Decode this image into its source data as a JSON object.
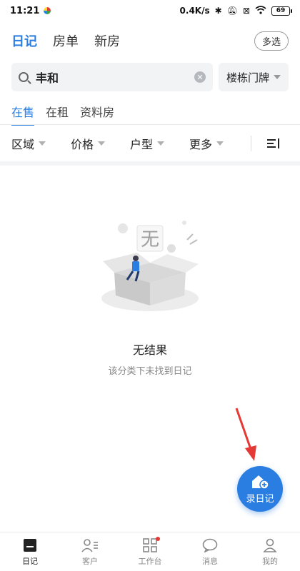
{
  "status_bar": {
    "time": "11:21",
    "speed": "0.4K/s",
    "battery": "69"
  },
  "top_nav": {
    "tabs": [
      {
        "label": "日记",
        "active": true
      },
      {
        "label": "房单",
        "active": false
      },
      {
        "label": "新房",
        "active": false
      }
    ],
    "multi_select_label": "多选"
  },
  "search": {
    "value": "丰和",
    "filter_label": "楼栋门牌"
  },
  "sub_tabs": [
    {
      "label": "在售",
      "active": true
    },
    {
      "label": "在租",
      "active": false
    },
    {
      "label": "资料房",
      "active": false
    }
  ],
  "filters": [
    "区域",
    "价格",
    "户型",
    "更多"
  ],
  "empty_state": {
    "illustration_text": "无",
    "title": "无结果",
    "subtitle": "该分类下未找到日记"
  },
  "fab": {
    "label": "录日记",
    "icon": "house-plus-icon"
  },
  "bottom_tabs": [
    {
      "label": "日记",
      "icon": "diary-icon",
      "active": true
    },
    {
      "label": "客户",
      "icon": "customer-icon",
      "active": false
    },
    {
      "label": "工作台",
      "icon": "grid-icon",
      "active": false,
      "badge": true
    },
    {
      "label": "消息",
      "icon": "message-icon",
      "active": false
    },
    {
      "label": "我的",
      "icon": "user-icon",
      "active": false
    }
  ],
  "colors": {
    "accent": "#2a7de1",
    "annotation": "#e53935",
    "badge": "#e53935"
  }
}
